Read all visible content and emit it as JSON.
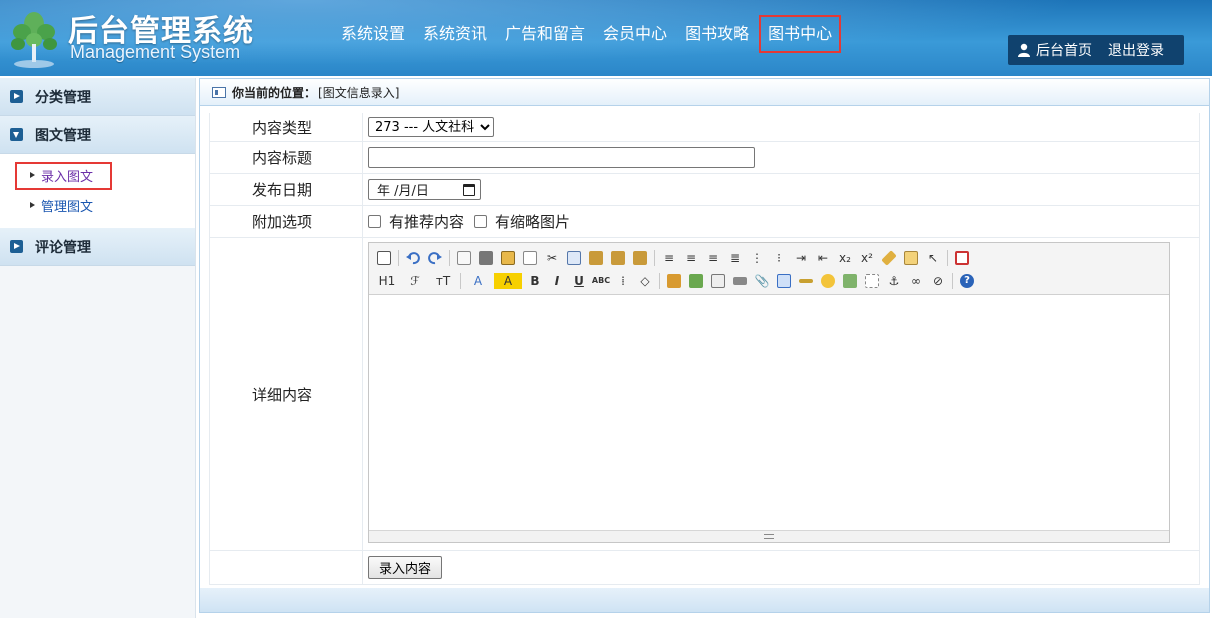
{
  "header": {
    "title": "后台管理系统",
    "subtitle": "Management System",
    "nav": [
      {
        "label": "系统设置",
        "highlighted": false
      },
      {
        "label": "系统资讯",
        "highlighted": false
      },
      {
        "label": "广告和留言",
        "highlighted": false
      },
      {
        "label": "会员中心",
        "highlighted": false
      },
      {
        "label": "图书攻略",
        "highlighted": false
      },
      {
        "label": "图书中心",
        "highlighted": true
      }
    ],
    "user": {
      "home_label": "后台首页",
      "logout_label": "退出登录"
    }
  },
  "sidebar": {
    "groups": [
      {
        "label": "分类管理",
        "expanded": false
      },
      {
        "label": "图文管理",
        "expanded": true,
        "items": [
          {
            "label": "录入图文",
            "active": true
          },
          {
            "label": "管理图文",
            "active": false
          }
        ]
      },
      {
        "label": "评论管理",
        "expanded": false
      }
    ]
  },
  "breadcrumb": {
    "prefix": "你当前的位置：",
    "location": "[图文信息录入]"
  },
  "form": {
    "type_label": "内容类型",
    "type_value": "273 --- 人文社科",
    "title_label": "内容标题",
    "title_value": "",
    "date_label": "发布日期",
    "date_placeholder": "年 /月/日",
    "options_label": "附加选项",
    "opt_recommend": "有推荐内容",
    "opt_thumb": "有缩略图片",
    "detail_label": "详细内容",
    "submit_label": "录入内容"
  },
  "editor": {
    "toolbar_row1": [
      "source-icon",
      "undo-icon",
      "redo-icon",
      "preview-icon",
      "print-icon",
      "template-icon",
      "code-icon",
      "cut-icon",
      "copy-icon",
      "paste-icon",
      "paste-text-icon",
      "paste-word-icon",
      "align-left-icon",
      "align-center-icon",
      "align-right-icon",
      "justify-icon",
      "ordered-list-icon",
      "unordered-list-icon",
      "indent-icon",
      "outdent-icon",
      "subscript-icon",
      "superscript-icon",
      "clear-format-icon",
      "select-all-icon",
      "pointer-icon",
      "fullscreen-icon"
    ],
    "toolbar_row2": [
      "heading-icon",
      "font-family-icon",
      "font-size-icon",
      "text-color-icon",
      "highlight-color-icon",
      "bold-icon",
      "italic-icon",
      "underline-icon",
      "strikethrough-icon",
      "line-height-icon",
      "remove-format-icon",
      "image-icon",
      "multi-image-icon",
      "flash-icon",
      "media-icon",
      "attachment-icon",
      "table-icon",
      "hr-icon",
      "emoticon-icon",
      "map-icon",
      "page-break-icon",
      "anchor-icon",
      "link-icon",
      "unlink-icon",
      "help-icon"
    ],
    "heading_text": "H1",
    "bold_text": "B",
    "italic_text": "I",
    "underline_text": "U",
    "strike_text": "ABC",
    "sub_text": "x₂",
    "sup_text": "x²",
    "font_text": "ℱ",
    "size_text": "тT",
    "color_text": "A",
    "help_text": "?"
  },
  "colors": {
    "header_blue": "#2b86c8",
    "userbox": "#10426e",
    "highlight_red": "#e53935",
    "sidebar_link": "#1a56b0",
    "active_link": "#6b2fa8"
  }
}
